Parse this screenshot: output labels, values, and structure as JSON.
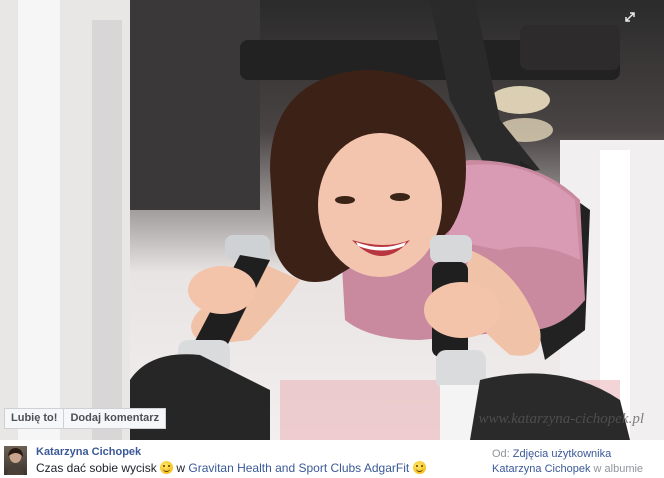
{
  "photo": {
    "alt": "Woman smiling while exercising on gym machine",
    "watermark": "www.katarzyna-cichopek.pl"
  },
  "actions": {
    "like_label": "Lubię to!",
    "comment_label": "Dodaj komentarz"
  },
  "post": {
    "author": "Katarzyna Cichopek",
    "text_before": "Czas dać sobie wycisk",
    "connector": " w ",
    "place": "Gravitan Health and Sport Clubs AdgarFit"
  },
  "source": {
    "prefix": "Od:",
    "album_link": "Zdjęcia użytkownika",
    "owner": "Katarzyna Cichopek",
    "suffix": "w albumie"
  },
  "icons": {
    "expand": "expand-icon",
    "emoji_grin": "grin-emoji-icon",
    "emoji_smile": "smile-emoji-icon"
  }
}
